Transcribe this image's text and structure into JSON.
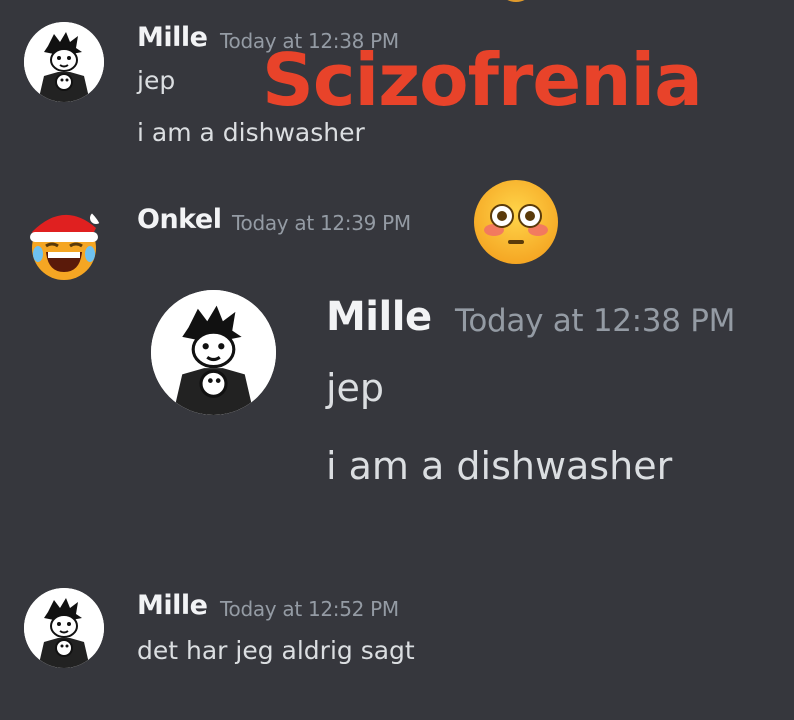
{
  "messages": [
    {
      "user": "Mille",
      "timestamp": "Today at 12:38 PM",
      "lines": [
        "jep",
        "i am a dishwasher"
      ]
    },
    {
      "user": "Onkel",
      "timestamp": "Today at 12:39 PM"
    },
    {
      "user": "Mille",
      "timestamp": "Today at 12:52 PM",
      "lines": [
        "det har jeg aldrig sagt"
      ]
    }
  ],
  "quoted": {
    "user": "Mille",
    "timestamp": "Today at 12:38 PM",
    "lines": [
      "jep",
      "i am a dishwasher"
    ]
  },
  "overlay": {
    "text": "Scizofrenia",
    "color": "#e8432a"
  },
  "emoji": {
    "name": "flushed-face-emoji"
  },
  "colors": {
    "background": "#36373d",
    "username": "#f2f3f5",
    "timestamp": "#949ba4",
    "text": "#dbdee1"
  }
}
